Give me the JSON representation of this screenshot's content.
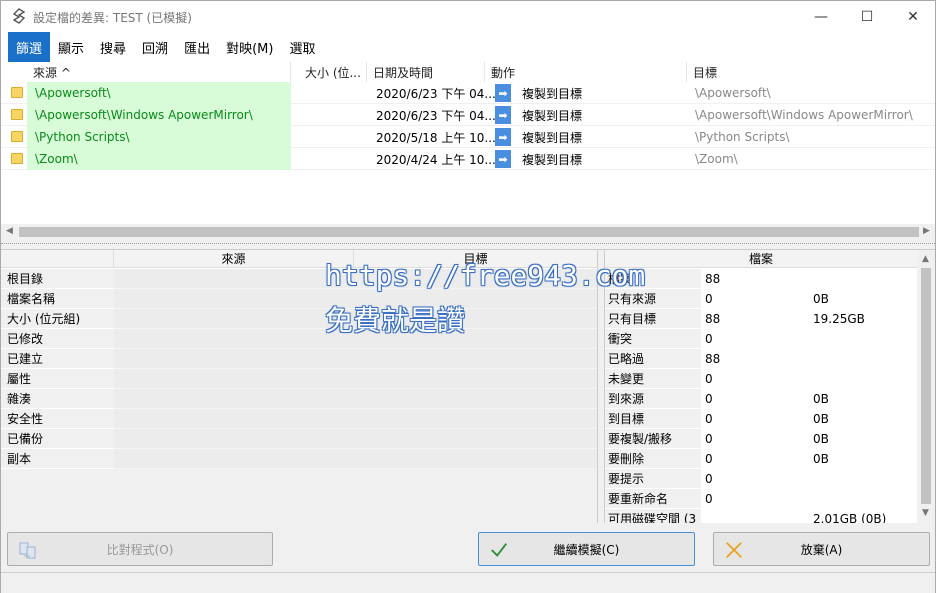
{
  "window": {
    "title": "設定檔的差異: TEST (已模擬)",
    "controls": {
      "minimize": "—",
      "maximize": "☐",
      "close": "✕"
    }
  },
  "menu": [
    {
      "label": "篩選",
      "active": true
    },
    {
      "label": "顯示"
    },
    {
      "label": "搜尋"
    },
    {
      "label": "回溯"
    },
    {
      "label": "匯出"
    },
    {
      "label": "對映(M)"
    },
    {
      "label": "選取"
    }
  ],
  "file_list": {
    "columns": {
      "source": "來源  ^",
      "size": "大小 (位...",
      "date": "日期及時間",
      "action": "動作",
      "target": "目標"
    },
    "rows": [
      {
        "source": "\\Apowersoft\\",
        "date": "2020/6/23 下午 04...",
        "action": "複製到目標",
        "target": "\\Apowersoft\\"
      },
      {
        "source": "\\Apowersoft\\Windows ApowerMirror\\",
        "date": "2020/6/23 下午 04...",
        "action": "複製到目標",
        "target": "\\Apowersoft\\Windows ApowerMirror\\"
      },
      {
        "source": "\\Python Scripts\\",
        "date": "2020/5/18 上午 10...",
        "action": "複製到目標",
        "target": "\\Python Scripts\\"
      },
      {
        "source": "\\Zoom\\",
        "date": "2020/4/24 上午 10...",
        "action": "複製到目標",
        "target": "\\Zoom\\"
      }
    ]
  },
  "properties": {
    "header_source": "來源",
    "header_target": "目標",
    "labels": [
      "根目錄",
      "檔案名稱",
      "大小 (位元組)",
      "已修改",
      "已建立",
      "屬性",
      "雜湊",
      "安全性",
      "已備份",
      "副本"
    ]
  },
  "stats": {
    "header": "檔案",
    "rows": [
      {
        "label": "檔案",
        "v1": "88",
        "v2": ""
      },
      {
        "label": "只有來源",
        "v1": "0",
        "v2": "0B"
      },
      {
        "label": "只有目標",
        "v1": "88",
        "v2": "19.25GB"
      },
      {
        "label": "衝突",
        "v1": "0",
        "v2": ""
      },
      {
        "label": "已略過",
        "v1": "88",
        "v2": ""
      },
      {
        "label": "未變更",
        "v1": "0",
        "v2": ""
      },
      {
        "label": "到來源",
        "v1": "0",
        "v2": "0B"
      },
      {
        "label": "到目標",
        "v1": "0",
        "v2": "0B"
      },
      {
        "label": "要複製/搬移",
        "v1": "0",
        "v2": "0B"
      },
      {
        "label": "要刪除",
        "v1": "0",
        "v2": "0B"
      },
      {
        "label": "要提示",
        "v1": "0",
        "v2": ""
      },
      {
        "label": "要重新命名",
        "v1": "0",
        "v2": ""
      },
      {
        "label": "可用磁碟空間 (3",
        "v1": "",
        "v2": "2.01GB (0B)"
      }
    ]
  },
  "watermark": {
    "line1": "https://free943.com",
    "line2": "免費就是讚"
  },
  "buttons": {
    "compare": "比對程式(O)",
    "continue": "繼續模擬(C)",
    "abort": "放棄(A)"
  }
}
